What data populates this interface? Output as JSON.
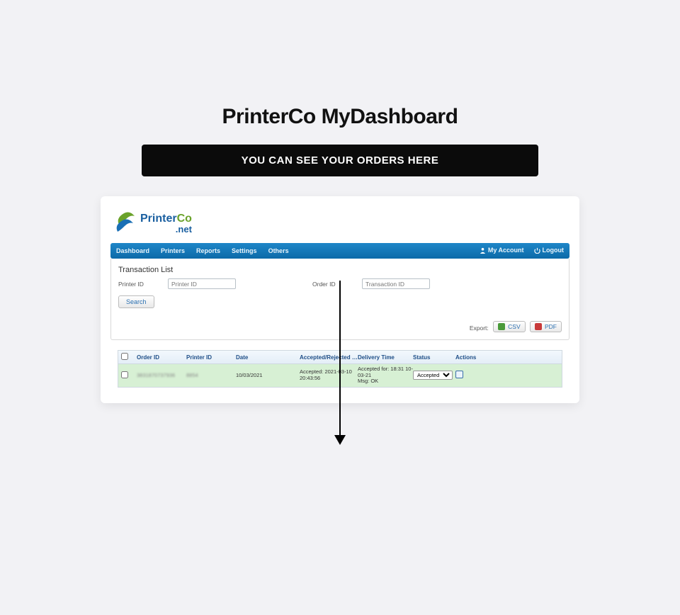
{
  "title": "PrinterCo MyDashboard",
  "banner": "YOU CAN SEE YOUR ORDERS HERE",
  "logo": {
    "brand1": "Printer",
    "brand2": "Co",
    "suffix": ".net"
  },
  "menu": {
    "items": [
      "Dashboard",
      "Printers",
      "Reports",
      "Settings",
      "Others"
    ],
    "right": {
      "account": "My Account",
      "logout": "Logout"
    }
  },
  "section": {
    "heading": "Transaction List",
    "filters": {
      "printer_label": "Printer ID",
      "printer_placeholder": "Printer ID",
      "order_label": "Order ID",
      "order_placeholder": "Transaction ID",
      "search": "Search"
    },
    "export": {
      "label": "Export:",
      "csv": "CSV",
      "pdf": "PDF"
    }
  },
  "table": {
    "headers": {
      "order_id": "Order ID",
      "printer_id": "Printer ID",
      "date": "Date",
      "acc_rej": "Accepted/Rejected Time",
      "delivery": "Delivery Time",
      "status": "Status",
      "actions": "Actions"
    },
    "row": {
      "order_id": "3831870737936",
      "printer_id": "8854",
      "date": "10/03/2021",
      "acc_rej": "Accepted: 2021-03-10 20:43:56",
      "delivery": "Accepted for: 18:31 10-03-21\nMsg: OK",
      "status": "Accepted"
    }
  }
}
